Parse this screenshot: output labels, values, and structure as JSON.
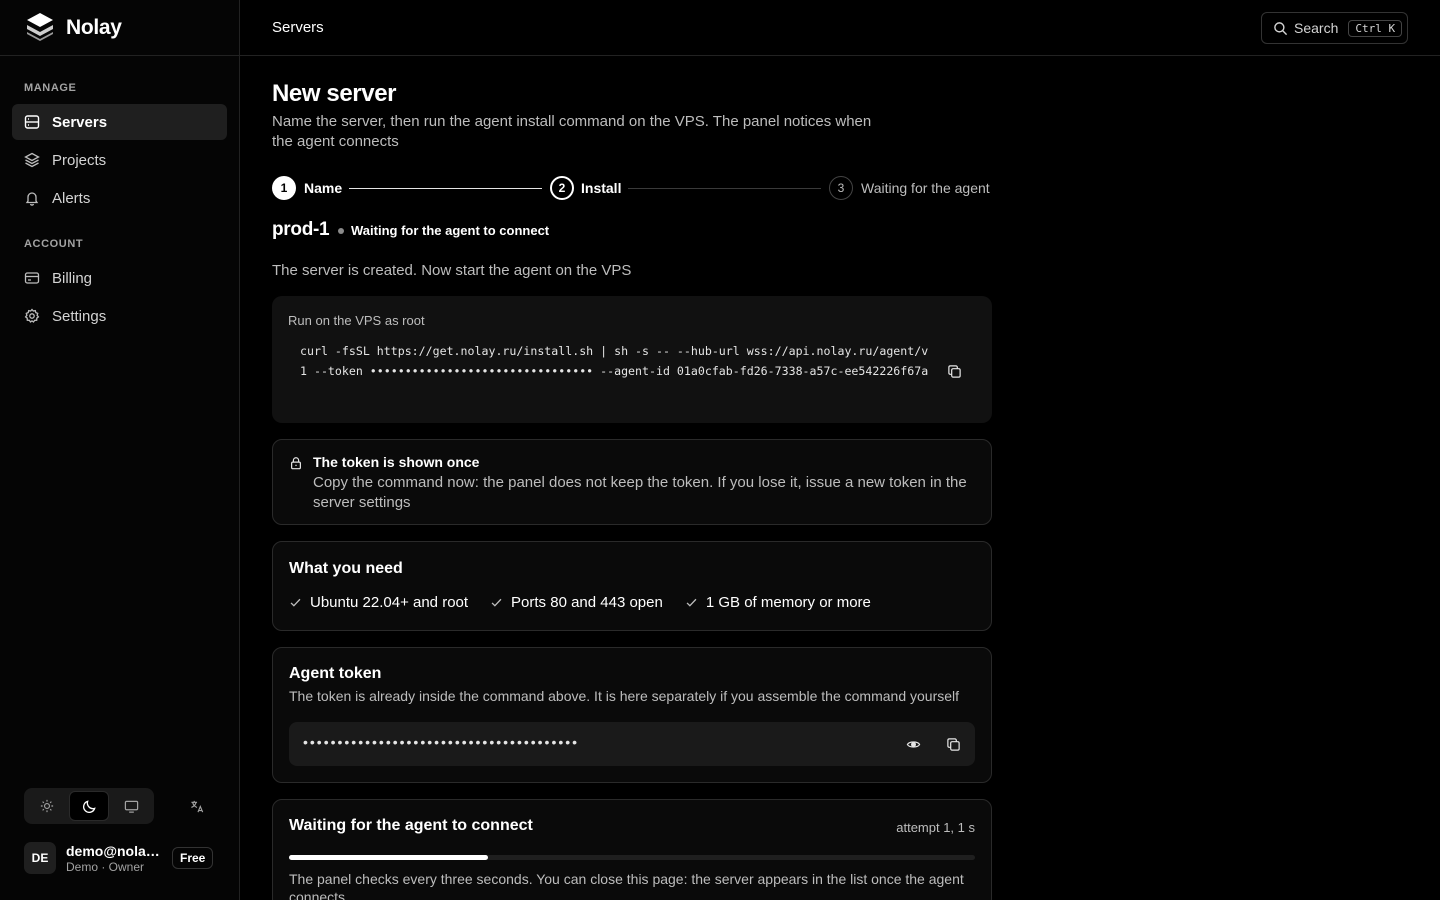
{
  "app": {
    "name": "Nolay"
  },
  "sidebar": {
    "manage_label": "MANAGE",
    "account_label": "ACCOUNT",
    "manage_items": [
      {
        "label": "Servers",
        "icon": "server-icon",
        "active": true
      },
      {
        "label": "Projects",
        "icon": "layers-icon",
        "active": false
      },
      {
        "label": "Alerts",
        "icon": "bell-icon",
        "active": false
      }
    ],
    "account_items": [
      {
        "label": "Billing",
        "icon": "credit-card-icon"
      },
      {
        "label": "Settings",
        "icon": "gear-icon"
      }
    ],
    "theme_options": [
      "light",
      "dark",
      "system"
    ],
    "theme_selected": "dark",
    "user": {
      "initials": "DE",
      "email": "demo@nolay…",
      "role": "Demo · Owner",
      "plan": "Free"
    }
  },
  "topbar": {
    "title": "Servers",
    "search_label": "Search",
    "search_shortcut": "Ctrl K"
  },
  "page": {
    "title": "New server",
    "subtitle": "Name the server, then run the agent install command on the VPS. The panel notices when the agent connects"
  },
  "stepper": {
    "steps": [
      {
        "number": "1",
        "label": "Name",
        "state": "done"
      },
      {
        "number": "2",
        "label": "Install",
        "state": "current"
      },
      {
        "number": "3",
        "label": "Waiting for the agent",
        "state": "pending"
      }
    ]
  },
  "server": {
    "name": "prod-1",
    "status": "Waiting for the agent to connect"
  },
  "created_text": "The server is created. Now start the agent on the VPS",
  "command": {
    "label": "Run on the VPS as root",
    "text": "curl -fsSL https://get.nolay.ru/install.sh | sh -s -- --hub-url wss://api.nolay.ru/agent/v1 --token •••••••••••••••••••••••••••••••• --agent-id 01a0cfab-fd26-7338-a57c-ee542226f67a"
  },
  "notice": {
    "title": "The token is shown once",
    "body": "Copy the command now: the panel does not keep the token. If you lose it, issue a new token in the server settings"
  },
  "requirements": {
    "title": "What you need",
    "items": [
      "Ubuntu 22.04+ and root",
      "Ports 80 and 443 open",
      "1 GB of memory or more"
    ]
  },
  "agent_token": {
    "title": "Agent token",
    "description": "The token is already inside the command above. It is here separately if you assemble the command yourself",
    "masked_value": "••••••••••••••••••••••••••••••••••••••••"
  },
  "waiting": {
    "title": "Waiting for the agent to connect",
    "attempt": "attempt 1, 1 s",
    "progress": 0.29,
    "body": "The panel checks every three seconds. You can close this page: the server appears in the list once the agent connects"
  },
  "colors": {
    "background": "#000000",
    "accent": "#ffffff",
    "muted": "#bdbdbd",
    "border": "#2a2a2a"
  }
}
